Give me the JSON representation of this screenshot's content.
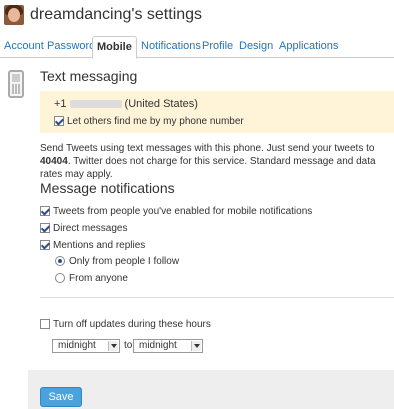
{
  "header": {
    "title": "dreamdancing's settings"
  },
  "tabs": [
    {
      "label": "Account"
    },
    {
      "label": "Password"
    },
    {
      "label": "Mobile"
    },
    {
      "label": "Notifications"
    },
    {
      "label": "Profile"
    },
    {
      "label": "Design"
    },
    {
      "label": "Applications"
    }
  ],
  "text_messaging": {
    "heading": "Text messaging",
    "country_code": "+1",
    "country": "(United States)",
    "find_me_label": "Let others find me by my phone number",
    "find_me_checked": true,
    "description_1": "Send Tweets using text messages with this phone. Just send your tweets to ",
    "shortcode": "40404",
    "description_2": ". Twitter does not charge for this service. Standard message and data rates may apply."
  },
  "notifications": {
    "heading": "Message notifications",
    "options": [
      {
        "label": "Tweets from people you've enabled for mobile notifications",
        "checked": true
      },
      {
        "label": "Direct messages",
        "checked": true
      },
      {
        "label": "Mentions and replies",
        "checked": true
      }
    ],
    "mentions_scope": [
      {
        "label": "Only from people I follow",
        "selected": true
      },
      {
        "label": "From anyone",
        "selected": false
      }
    ]
  },
  "quiet_hours": {
    "label": "Turn off updates during these hours",
    "checked": false,
    "from_value": "midnight",
    "to_label": "to",
    "to_value": "midnight"
  },
  "footer": {
    "save_label": "Save"
  },
  "icons": {
    "phone": "mobile-phone-icon",
    "avatar": "user-avatar"
  },
  "colors": {
    "link": "#2276bb",
    "highlight_box": "#fff3d8",
    "save_button": "#4aa3df",
    "footer_bg": "#eeeeee"
  }
}
